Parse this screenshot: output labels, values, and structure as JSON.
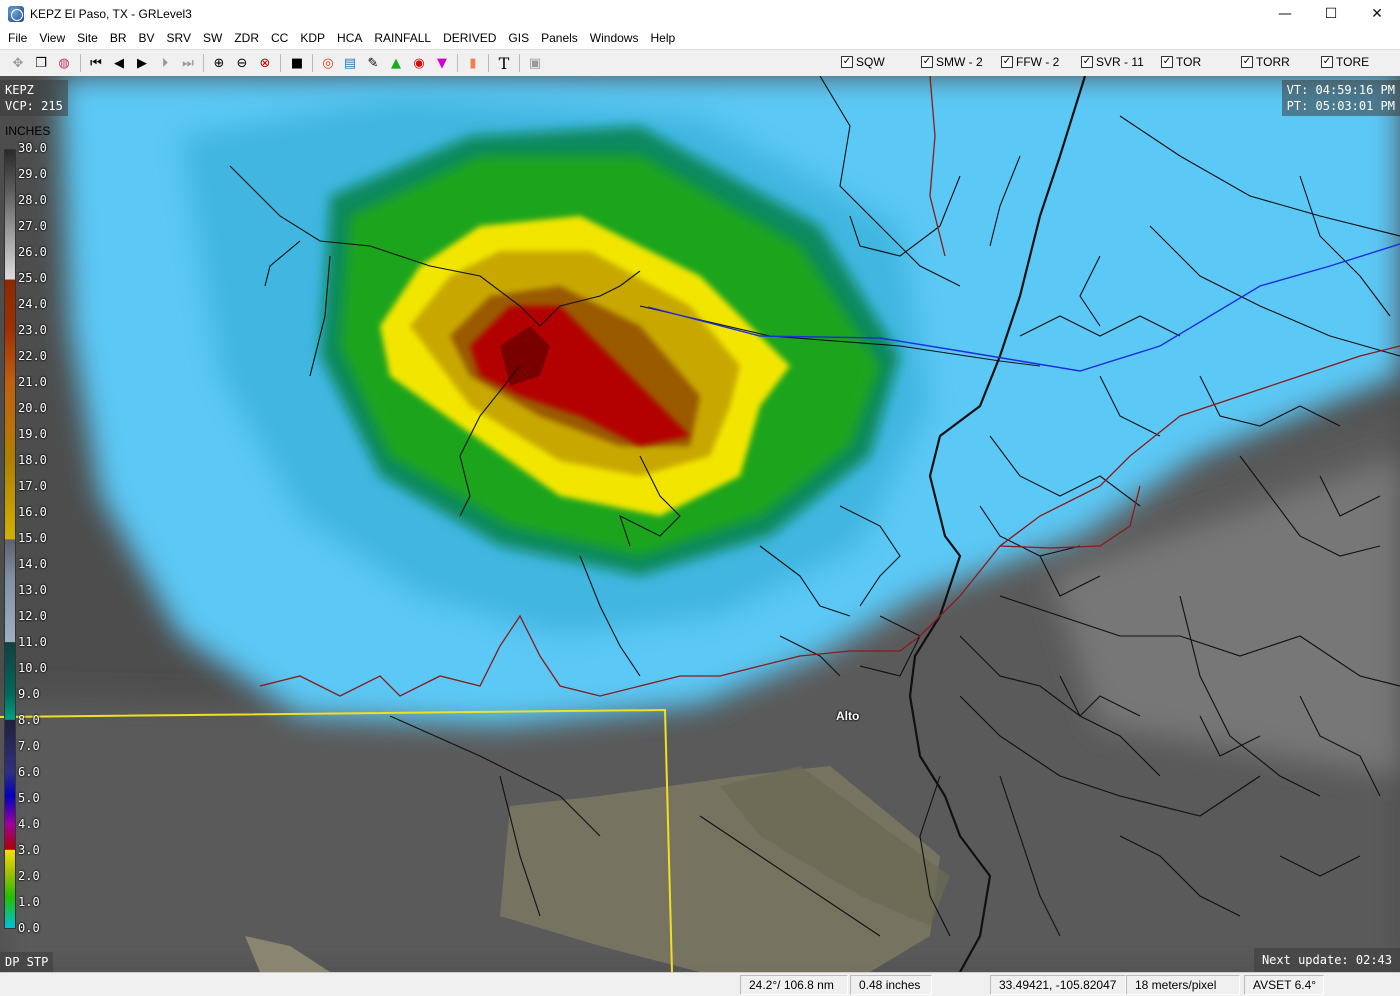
{
  "window": {
    "title": "KEPZ El Paso, TX - GRLevel3",
    "controls": {
      "minimize": "—",
      "maximize": "☐",
      "close": "✕"
    }
  },
  "menu": [
    "File",
    "View",
    "Site",
    "BR",
    "BV",
    "SRV",
    "SW",
    "ZDR",
    "CC",
    "KDP",
    "HCA",
    "RAINFALL",
    "DERIVED",
    "GIS",
    "Panels",
    "Windows",
    "Help"
  ],
  "toolbar": {
    "icons": [
      "pan-icon",
      "copy-icon",
      "globe-icon",
      "first-frame-icon",
      "prev-frame-icon",
      "play-icon",
      "next-frame-icon",
      "last-frame-icon",
      "zoom-in-icon",
      "zoom-out-icon",
      "zoom-reset-icon",
      "stop-icon",
      "storm-track-icon",
      "legend-icon",
      "inspect-icon",
      "triangle-icon",
      "circle-icon",
      "inverted-triangle-icon",
      "orange-box-icon",
      "text-icon",
      "panel-icon"
    ],
    "warnings": [
      {
        "label": "SQW",
        "checked": true
      },
      {
        "label": "SMW - 2",
        "checked": true
      },
      {
        "label": "FFW - 2",
        "checked": true
      },
      {
        "label": "SVR - 11",
        "checked": true
      },
      {
        "label": "TOR",
        "checked": true
      },
      {
        "label": "TORR",
        "checked": true
      },
      {
        "label": "TORE",
        "checked": true
      }
    ]
  },
  "map": {
    "site": "KEPZ",
    "vcp": "VCP: 215",
    "valid_time": "VT: 04:59:16 PM",
    "product_time": "PT: 05:03:01 PM",
    "units": "INCHES",
    "product": "DP STP",
    "next_update": "Next update: 02:43",
    "city": "Alto",
    "legend_labels": [
      "30.0",
      "29.0",
      "28.0",
      "27.0",
      "26.0",
      "25.0",
      "24.0",
      "23.0",
      "22.0",
      "21.0",
      "20.0",
      "19.0",
      "18.0",
      "17.0",
      "16.0",
      "15.0",
      "14.0",
      "13.0",
      "12.0",
      "11.0",
      "10.0",
      "9.0",
      "8.0",
      "7.0",
      "6.0",
      "5.0",
      "4.0",
      "3.0",
      "2.0",
      "1.0",
      "0.0"
    ],
    "colors": {
      "light_blue": "#5cc8f5",
      "green": "#1ea51e",
      "yellow": "#f2e600",
      "red": "#b30000",
      "county_line": "#f0e020",
      "river": "#1a2ee0",
      "road": "#101010",
      "highway": "#8b1a1a"
    }
  },
  "status": {
    "azimuth_range": "24.2°/ 106.8 nm",
    "value": "0.48 inches",
    "coords": "33.49421, -105.82047",
    "scale": "18 meters/pixel",
    "avset": "AVSET 6.4°"
  }
}
